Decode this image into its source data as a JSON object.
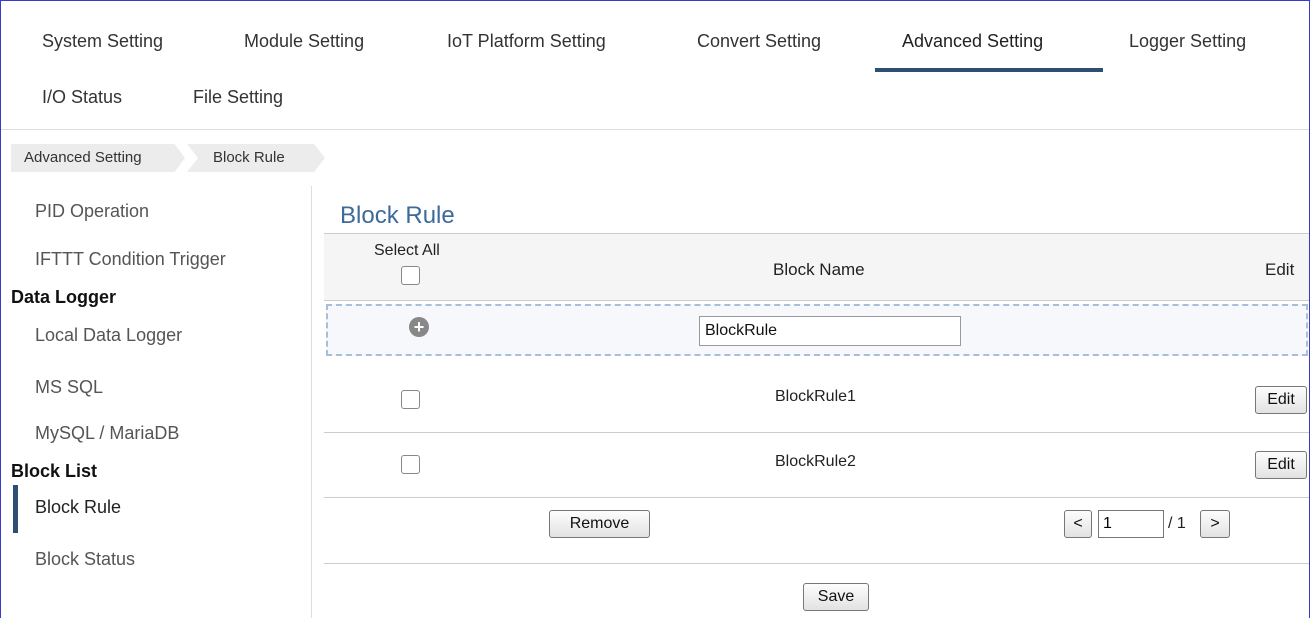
{
  "top_tabs": [
    "System Setting",
    "Module Setting",
    "IoT Platform Setting",
    "Convert Setting",
    "Advanced Setting",
    "Logger Setting",
    "I/O Status",
    "File Setting"
  ],
  "breadcrumb": [
    "Advanced Setting",
    "Block Rule"
  ],
  "sidebar": {
    "items": [
      "PID Operation",
      "IFTTT Condition Trigger"
    ],
    "group_data_logger": "Data Logger",
    "data_logger_items": [
      "Local Data Logger",
      "MS SQL",
      "MySQL / MariaDB"
    ],
    "group_block_list": "Block List",
    "block_list_items": [
      "Block Rule",
      "Block Status"
    ]
  },
  "main": {
    "title": "Block Rule",
    "header": {
      "select_all": "Select All",
      "block_name": "Block Name",
      "edit": "Edit"
    },
    "new_block_value": "BlockRule",
    "rows": [
      {
        "name": "BlockRule1",
        "edit_label": "Edit"
      },
      {
        "name": "BlockRule2",
        "edit_label": "Edit"
      }
    ],
    "remove_label": "Remove",
    "pager": {
      "prev": "<",
      "page": "1",
      "total": "/ 1",
      "next": ">"
    },
    "save_label": "Save"
  },
  "colors": {
    "accent": "#2e4f73",
    "title": "#3d6a9a",
    "dashed_border": "#a9bfd8"
  }
}
